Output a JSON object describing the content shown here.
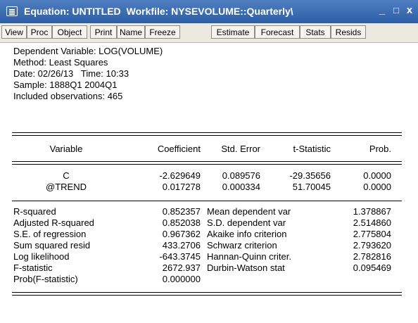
{
  "window": {
    "title_main": "Equation: UNTITLED",
    "title_workfile": "Workfile: NYSEVOLUME::Quarterly\\",
    "minimize": "_",
    "maximize": "□",
    "close": "x"
  },
  "toolbar": {
    "buttons": [
      "View",
      "Proc",
      "Object",
      "Print",
      "Name",
      "Freeze",
      "Estimate",
      "Forecast",
      "Stats",
      "Resids"
    ]
  },
  "output": {
    "header": [
      "Dependent Variable: LOG(VOLUME)",
      "Method: Least Squares",
      "Date: 02/26/13   Time: 10:33",
      "Sample: 1888Q1 2004Q1",
      "Included observations: 465"
    ],
    "columns": [
      "Variable",
      "Coefficient",
      "Std. Error",
      "t-Statistic",
      "Prob."
    ],
    "rows": [
      [
        "C",
        "-2.629649",
        "0.089576",
        "-29.35656",
        "0.0000"
      ],
      [
        "@TREND",
        "0.017278",
        "0.000334",
        "51.70045",
        "0.0000"
      ]
    ],
    "stats_left": [
      [
        "R-squared",
        "0.852357"
      ],
      [
        "Adjusted R-squared",
        "0.852038"
      ],
      [
        "S.E. of regression",
        "0.967362"
      ],
      [
        "Sum squared resid",
        "433.2706"
      ],
      [
        "Log likelihood",
        "-643.3745"
      ],
      [
        "F-statistic",
        "2672.937"
      ],
      [
        "Prob(F-statistic)",
        "0.000000"
      ]
    ],
    "stats_right": [
      [
        "Mean dependent var",
        "1.378867"
      ],
      [
        "S.D. dependent var",
        "2.514860"
      ],
      [
        "Akaike info criterion",
        "2.775804"
      ],
      [
        "Schwarz criterion",
        "2.793620"
      ],
      [
        "Hannan-Quinn criter.",
        "2.782816"
      ],
      [
        "Durbin-Watson stat",
        "0.095469"
      ]
    ]
  }
}
